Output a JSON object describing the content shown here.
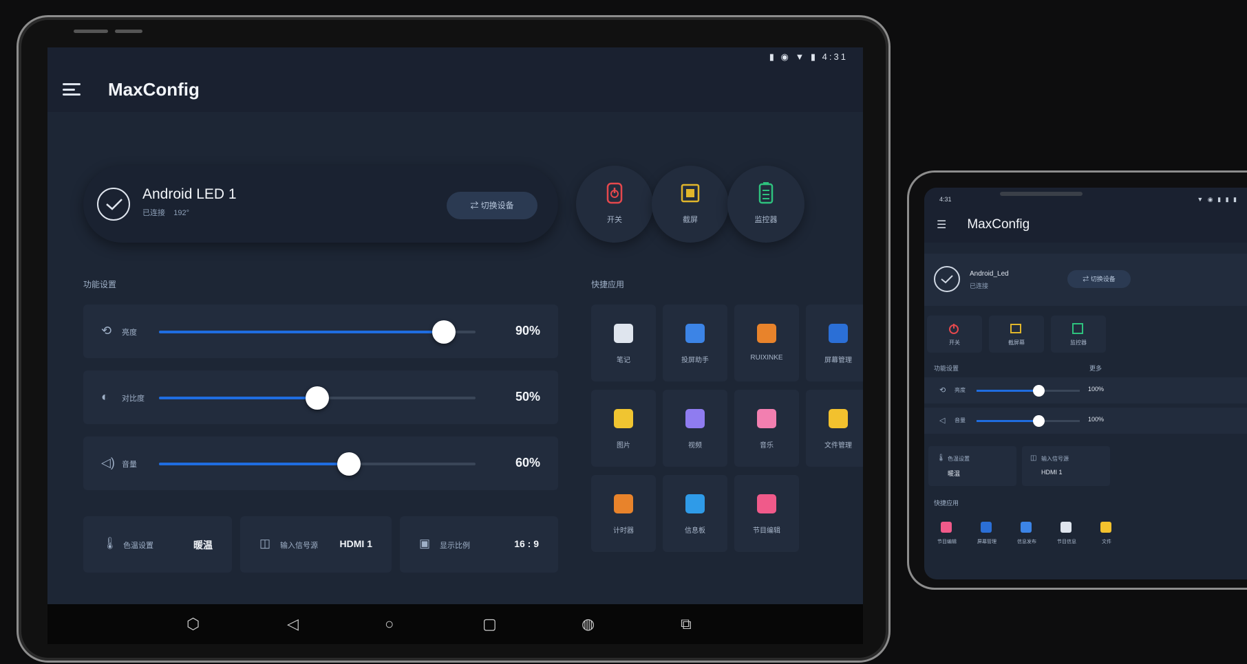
{
  "tablet": {
    "status_icons": "▮ ◉ ▼ ▮ 4:31",
    "app_title": "MaxConfig",
    "device": {
      "name": "Android LED 1",
      "status": "已连接",
      "status_extra": "192°",
      "switch_label": "切换设备"
    },
    "quick_actions": [
      {
        "label": "开关",
        "icon": "power-icon",
        "color": "#e5484d"
      },
      {
        "label": "截屏",
        "icon": "screen-icon",
        "color": "#e1b62b"
      },
      {
        "label": "监控器",
        "icon": "battery-icon",
        "color": "#2ec27e"
      }
    ],
    "settings_label": "功能设置",
    "sliders": [
      {
        "icon": "⟲",
        "name": "亮度",
        "value": 90,
        "label": "90%"
      },
      {
        "icon": "◐",
        "name": "对比度",
        "value": 50,
        "label": "50%"
      },
      {
        "icon": "◁)",
        "name": "音量",
        "value": 60,
        "label": "60%"
      }
    ],
    "info_cards": [
      {
        "icon": "🌡",
        "name": "色温设置",
        "value": "暖温"
      },
      {
        "icon": "◫",
        "name": "输入信号源",
        "value": "HDMI 1"
      },
      {
        "icon": "▣",
        "name": "显示比例",
        "value": "16 : 9"
      }
    ],
    "apps_label": "快捷应用",
    "apps": [
      {
        "label": "笔记",
        "color": "#dfe5ee"
      },
      {
        "label": "投屏助手",
        "color": "#3c84e6"
      },
      {
        "label": "RUIXINKE",
        "color": "#e8832b"
      },
      {
        "label": "屏幕管理",
        "color": "#2b6fd6"
      },
      {
        "label": "图片",
        "color": "#f0c531"
      },
      {
        "label": "视频",
        "color": "#8f7cf0"
      },
      {
        "label": "音乐",
        "color": "#f27fb0"
      },
      {
        "label": "文件管理",
        "color": "#f2c12e"
      },
      {
        "label": "计时器",
        "color": "#e8832b"
      },
      {
        "label": "信息板",
        "color": "#2f9be8"
      },
      {
        "label": "节目编辑",
        "color": "#f05a8a"
      }
    ],
    "nav_icons": [
      "⬡",
      "◁",
      "○",
      "▢",
      "◍",
      "⧉"
    ]
  },
  "phone": {
    "time": "4:31",
    "status_icons": "▼ ◉ ▮ ▮ ▮",
    "app_title": "MaxConfig",
    "device": {
      "name": "Android_Led",
      "status": "已连接",
      "switch_label": "切换设备"
    },
    "quick_actions": [
      {
        "label": "开关",
        "color": "#e5484d"
      },
      {
        "label": "截屏幕",
        "color": "#e1b62b"
      },
      {
        "label": "监控器",
        "color": "#2ec27e"
      }
    ],
    "settings_label": "功能设置",
    "settings_more": "更多",
    "sliders": [
      {
        "icon": "⟲",
        "name": "亮度",
        "value": 60,
        "label": "100%"
      },
      {
        "icon": "◁",
        "name": "音量",
        "value": 60,
        "label": "100%"
      }
    ],
    "info_cards": [
      {
        "icon": "🌡",
        "name": "色温设置",
        "value": "暖温"
      },
      {
        "icon": "◫",
        "name": "输入信号源",
        "value": "HDMI 1"
      }
    ],
    "apps_label": "快捷应用",
    "apps": [
      {
        "label": "节目编辑",
        "color": "#f05a8a"
      },
      {
        "label": "屏幕管理",
        "color": "#2b6fd6"
      },
      {
        "label": "信息发布",
        "color": "#3c84e6"
      },
      {
        "label": "节目信息",
        "color": "#dfe5ee"
      },
      {
        "label": "文件",
        "color": "#f2c12e"
      }
    ]
  }
}
